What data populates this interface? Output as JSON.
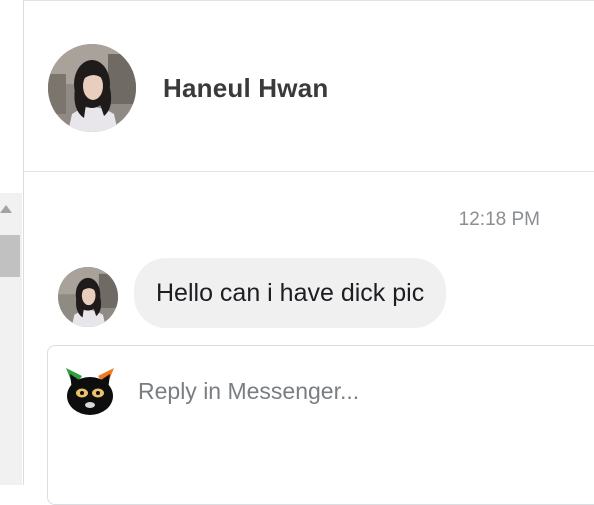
{
  "contact": {
    "name": "Haneul Hwan"
  },
  "messages": [
    {
      "time": "12:18 PM",
      "text": "Hello can i have dick pic"
    }
  ],
  "reply": {
    "placeholder": "Reply in Messenger..."
  },
  "colors": {
    "bubble_bg": "#f0f0f0",
    "name_text": "#3a3a3a",
    "timestamp_text": "#8a8d91",
    "border": "#dadde1"
  },
  "icons": {
    "contact_avatar": "profile-photo",
    "user_avatar": "black-cat-avatar"
  }
}
